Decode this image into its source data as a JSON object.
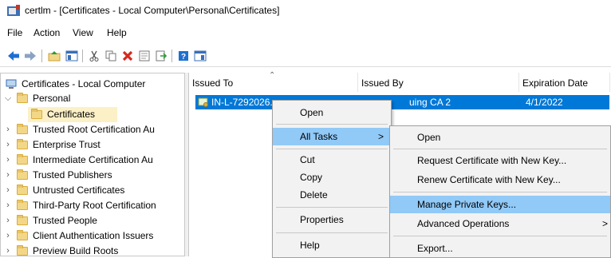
{
  "window": {
    "title": "certlm - [Certificates - Local Computer\\Personal\\Certificates]",
    "icon": "certlm-app-icon"
  },
  "menubar": [
    "File",
    "Action",
    "View",
    "Help"
  ],
  "toolbar": {
    "icons": [
      "back-arrow-icon",
      "forward-arrow-icon",
      "up-folder-icon",
      "show-hide-tree-icon",
      "cut-icon",
      "copy-icon",
      "delete-icon",
      "properties-icon",
      "export-icon",
      "help-icon",
      "action-pane-icon"
    ]
  },
  "tree": {
    "root": "Certificates - Local Computer",
    "items": [
      {
        "label": "Personal",
        "expanded": true
      },
      {
        "label": "Certificates",
        "selected": true
      },
      {
        "label": "Trusted Root Certification Au"
      },
      {
        "label": "Enterprise Trust"
      },
      {
        "label": "Intermediate Certification Au"
      },
      {
        "label": "Trusted Publishers"
      },
      {
        "label": "Untrusted Certificates"
      },
      {
        "label": "Third-Party Root Certification"
      },
      {
        "label": "Trusted People"
      },
      {
        "label": "Client Authentication Issuers"
      },
      {
        "label": "Preview Build Roots"
      }
    ]
  },
  "list": {
    "columns": [
      "Issued To",
      "Issued By",
      "Expiration Date"
    ],
    "rows": [
      {
        "issued_to": "IN-L-7292026.as",
        "issued_by": "uing CA 2",
        "expiration": "4/1/2022"
      }
    ]
  },
  "context_menu": {
    "items": [
      "Open",
      "All Tasks",
      "Cut",
      "Copy",
      "Delete",
      "Properties",
      "Help"
    ],
    "submenu_arrow": ">"
  },
  "submenu": {
    "items": [
      "Open",
      "Request Certificate with New Key...",
      "Renew Certificate with New Key...",
      "Manage Private Keys...",
      "Advanced Operations",
      "Export..."
    ],
    "submenu_arrow": ">"
  },
  "colors": {
    "selection": "#0078d7",
    "menu_highlight": "#91c9f7",
    "tree_selected": "#fcf0c6"
  }
}
